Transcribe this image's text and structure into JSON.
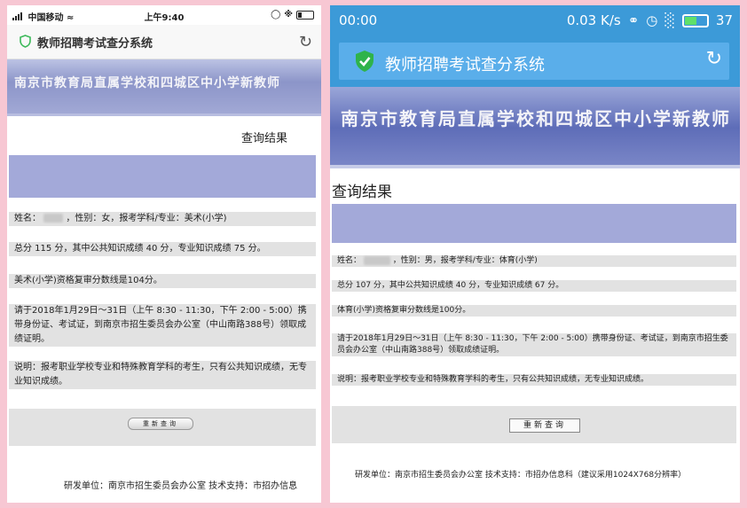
{
  "left": {
    "status": {
      "carrier": "中国移动",
      "time": "上午9:40"
    },
    "nav": {
      "title": "教师招聘考试查分系统"
    },
    "banner": "南京市教育局直属学校和四城区中小学新教师",
    "result_title": "查询结果",
    "rows": [
      "姓名：",
      "，性别：女，报考学科/专业：美术(小学)",
      "总分 115 分，其中公共知识成绩 40 分，专业知识成绩 75 分。",
      "美术(小学)资格复审分数线是104分。",
      "请于2018年1月29日～31日（上午 8:30 - 11:30，下午 2:00 - 5:00）携带身份证、考试证，到南京市招生委员会办公室（中山南路388号）领取成绩证明。",
      "说明：报考职业学校专业和特殊教育学科的考生，只有公共知识成绩，无专业知识成绩。"
    ],
    "reset_button": "重新查询",
    "footer": "研发单位：南京市招生委员会办公室 技术支持：市招办信息"
  },
  "right": {
    "status": {
      "time": "00:00",
      "speed": "0.03 K/s",
      "battery": "37"
    },
    "nav": {
      "title": "教师招聘考试查分系统"
    },
    "banner": "南京市教育局直属学校和四城区中小学新教师",
    "result_title": "查询结果",
    "rows": [
      "姓名：",
      "，性别：男，报考学科/专业：体育(小学)",
      "总分 107 分，其中公共知识成绩 40 分，专业知识成绩 67 分。",
      "体育(小学)资格复审分数线是100分。",
      "请于2018年1月29日～31日（上午 8:30 - 11:30，下午 2:00 - 5:00）携带身份证、考试证，到南京市招生委员会办公室（中山南路388号）领取成绩证明。",
      "说明：报考职业学校专业和特殊教育学科的考生，只有公共知识成绩，无专业知识成绩。"
    ],
    "reset_button": "重新查询",
    "footer": "研发单位：南京市招生委员会办公室 技术支持：市招办信息科（建议采用1024X768分辨率）"
  },
  "colors": {
    "accent_blue": "#3c9ad8",
    "banner_purple": "#8c95c9",
    "row_purple": "#a3a9d9",
    "background_pink": "#f7c7d3"
  },
  "icons": [
    "shield-check-icon",
    "reload-icon",
    "wifi-icon",
    "signal-icon",
    "battery-icon",
    "headphone-icon",
    "alarm-icon"
  ]
}
